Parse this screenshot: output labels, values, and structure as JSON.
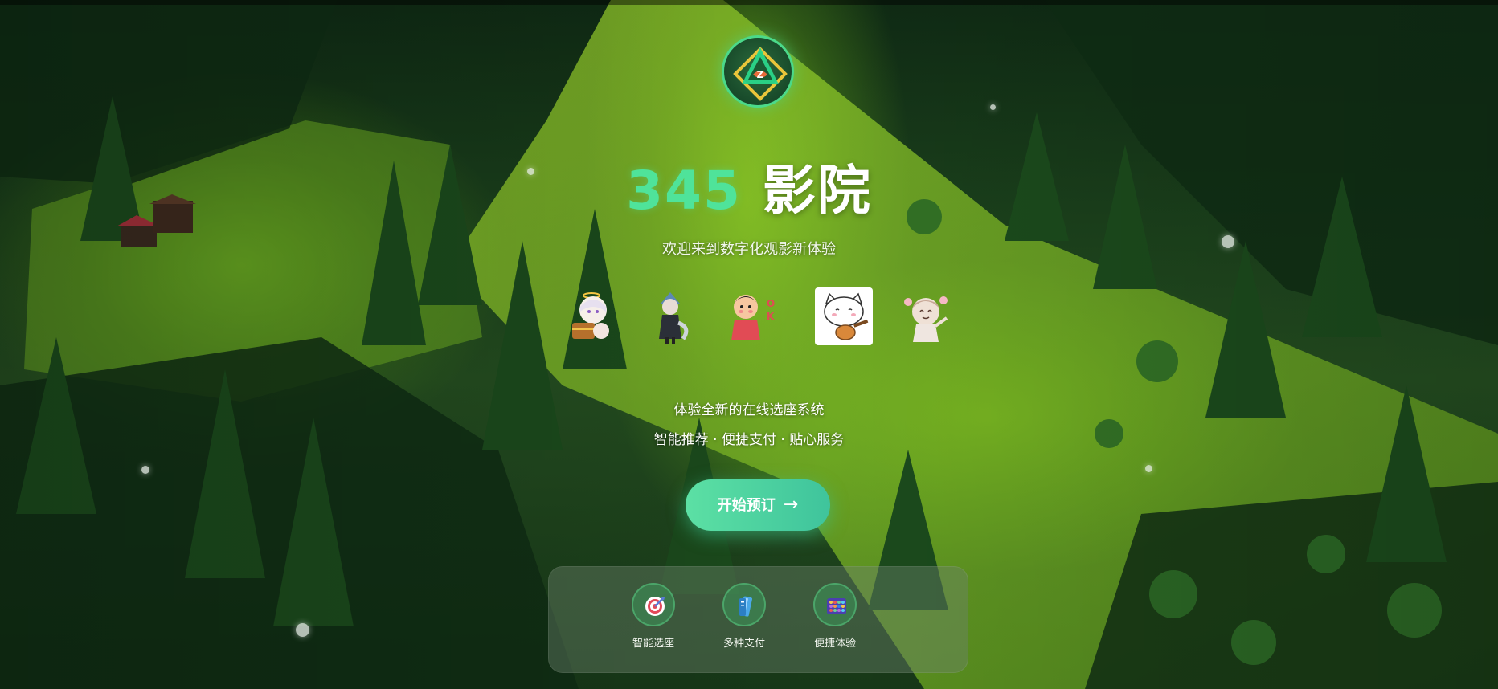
{
  "brand": {
    "number": "345",
    "name": "影院",
    "logo_icon": "triangle-diamond-logo-icon"
  },
  "hero": {
    "subtitle": "欢迎来到数字化观影新体验",
    "stickers": [
      {
        "name": "anime-girl-chest-sticker"
      },
      {
        "name": "dark-character-sticker"
      },
      {
        "name": "ok-kid-sticker"
      },
      {
        "name": "cat-guitar-sticker"
      },
      {
        "name": "flower-girl-sticker"
      }
    ],
    "feature_line_1": "体验全新的在线选座系统",
    "feature_line_2": "智能推荐 · 便捷支付 · 贴心服务"
  },
  "cta": {
    "label": "开始预订",
    "arrow": "→"
  },
  "features": [
    {
      "label": "智能选座",
      "icon": "target-icon"
    },
    {
      "label": "多种支付",
      "icon": "card-icon"
    },
    {
      "label": "便捷体验",
      "icon": "grid-icon"
    }
  ],
  "colors": {
    "accent": "#4fe39a",
    "cta_start": "#5ce0a4",
    "cta_end": "#3fc49c"
  }
}
